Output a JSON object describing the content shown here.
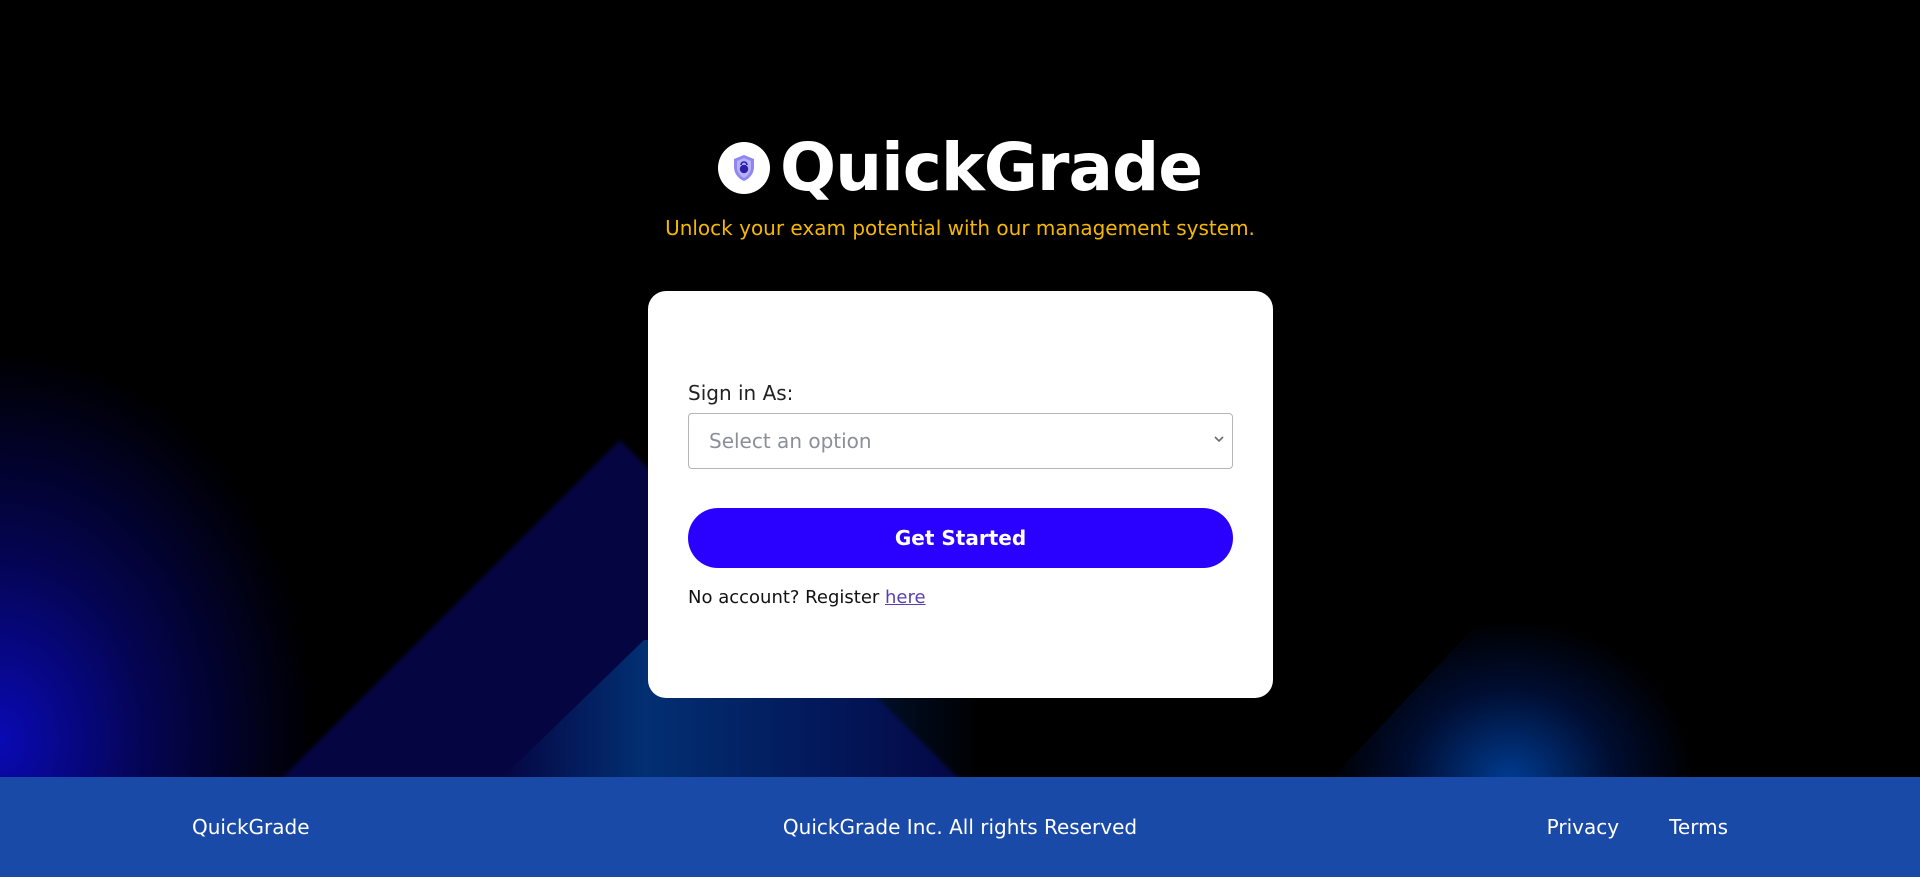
{
  "brand": {
    "title": "QuickGrade",
    "tagline": "Unlock your exam potential with our management system.",
    "logo_icon": "shield-lock-icon"
  },
  "signin_form": {
    "label": "Sign in As:",
    "select_placeholder": "Select an option",
    "submit_label": "Get Started",
    "register_prompt": "No account? Register ",
    "register_link": "here"
  },
  "footer": {
    "brand": "QuickGrade",
    "copyright": "QuickGrade Inc. All rights Reserved",
    "links": [
      "Privacy",
      "Terms"
    ]
  },
  "colors": {
    "background": "#000000",
    "accent": "#2a00ff",
    "tagline": "#f5b800",
    "footer": "#1a4aa8",
    "card": "#ffffff",
    "link": "#5a3fb0"
  }
}
